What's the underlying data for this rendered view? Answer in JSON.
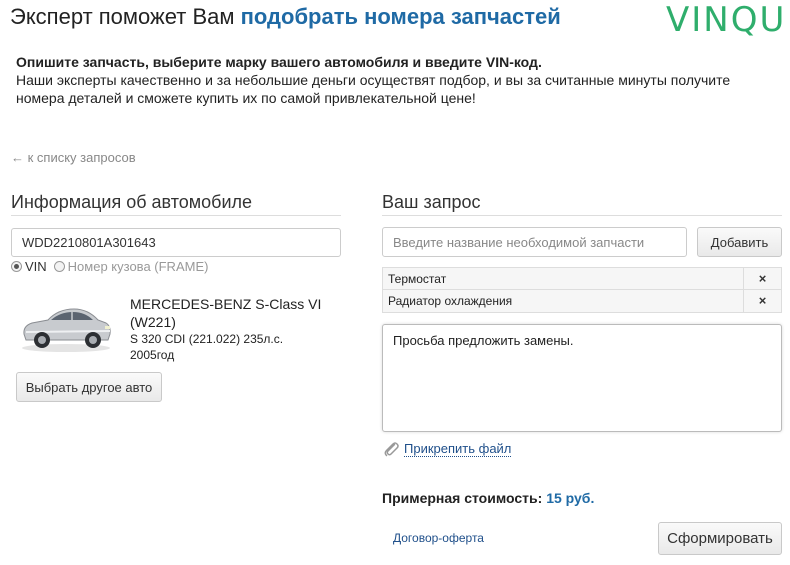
{
  "header": {
    "title_plain": "Эксперт поможет Вам",
    "title_accent": "подобрать номера запчастей",
    "logo": "VINQU"
  },
  "intro": {
    "lead": "Опишите запчасть, выберите марку вашего автомобиля и введите VIN-код.",
    "body": "Наши эксперты качественно и за небольшие деньги осуществят подбор, и вы за считанные минуты получите номера деталей и сможете купить их по самой привлекательной цене!"
  },
  "back_link": "← к списку запросов",
  "car_section": {
    "title": "Информация об автомобиле",
    "vin_value": "WDD2210801A301643",
    "radio_vin": "VIN",
    "radio_frame": "Номер кузова (FRAME)",
    "car_name": "MERCEDES-BENZ S-Class VI (W221)",
    "car_engine": "S 320 CDI (221.022) 235л.с.",
    "car_year": "2005год",
    "change_button": "Выбрать другое авто"
  },
  "request_section": {
    "title": "Ваш запрос",
    "part_placeholder": "Введите название необходимой запчасти",
    "add_button": "Добавить",
    "parts": [
      {
        "label": "Термостат",
        "remove": "×"
      },
      {
        "label": "Радиатор охлаждения",
        "remove": "×"
      }
    ],
    "comment": "Просьба предложить замены.",
    "attach_label": "Прикрепить файл",
    "price_label": "Примерная стоимость:",
    "price_value": "15 руб.",
    "offer_link": "Договор-оферта",
    "submit_button": "Сформировать"
  },
  "icons": {
    "attach": "paperclip-icon",
    "car": "car-thumbnail"
  },
  "colors": {
    "accent": "#1f6aa5",
    "logo": "#2fae6c",
    "link": "#1f4f8a"
  }
}
